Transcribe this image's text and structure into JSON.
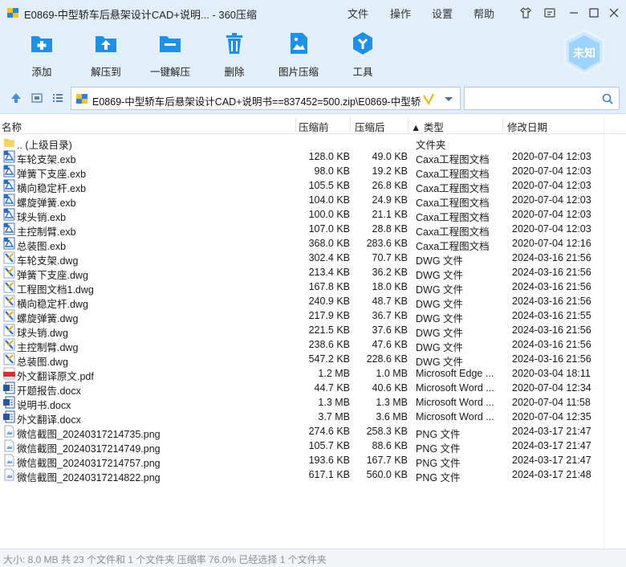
{
  "window": {
    "title": "E0869-中型轿车后悬架设计CAD+说明... - 360压缩",
    "menus": [
      "文件",
      "操作",
      "设置",
      "帮助"
    ]
  },
  "toolbar": {
    "buttons": [
      {
        "label": "添加",
        "icon": "add-icon"
      },
      {
        "label": "解压到",
        "icon": "extract-to-icon"
      },
      {
        "label": "一键解压",
        "icon": "quick-extract-icon"
      },
      {
        "label": "删除",
        "icon": "trash-icon"
      },
      {
        "label": "图片压缩",
        "icon": "image-compress-icon"
      },
      {
        "label": "工具",
        "icon": "tools-icon"
      }
    ],
    "badge": "未知"
  },
  "address": {
    "path": "E0869-中型轿车后悬架设计CAD+说明书==837452=500.zip\\E0869-中型轿",
    "search_placeholder": ""
  },
  "columns": {
    "name": "名称",
    "size": "压缩前",
    "packed": "压缩后",
    "type": "▲ 类型",
    "modified": "修改日期"
  },
  "files": [
    {
      "name": ".. (上级目录)",
      "size": "",
      "packed": "",
      "type": "文件夹",
      "date": "",
      "icon": "folder-up"
    },
    {
      "name": "车轮支架.exb",
      "size": "128.0 KB",
      "packed": "49.0 KB",
      "type": "Caxa工程图文档",
      "date": "2020-07-04 12:03",
      "icon": "exb"
    },
    {
      "name": "弹簧下支座.exb",
      "size": "98.0 KB",
      "packed": "19.2 KB",
      "type": "Caxa工程图文档",
      "date": "2020-07-04 12:03",
      "icon": "exb"
    },
    {
      "name": "横向稳定杆.exb",
      "size": "105.5 KB",
      "packed": "26.8 KB",
      "type": "Caxa工程图文档",
      "date": "2020-07-04 12:03",
      "icon": "exb"
    },
    {
      "name": "螺旋弹簧.exb",
      "size": "104.0 KB",
      "packed": "24.9 KB",
      "type": "Caxa工程图文档",
      "date": "2020-07-04 12:03",
      "icon": "exb"
    },
    {
      "name": "球头销.exb",
      "size": "100.0 KB",
      "packed": "21.1 KB",
      "type": "Caxa工程图文档",
      "date": "2020-07-04 12:03",
      "icon": "exb"
    },
    {
      "name": "主控制臂.exb",
      "size": "107.0 KB",
      "packed": "28.8 KB",
      "type": "Caxa工程图文档",
      "date": "2020-07-04 12:03",
      "icon": "exb"
    },
    {
      "name": "总装图.exb",
      "size": "368.0 KB",
      "packed": "283.6 KB",
      "type": "Caxa工程图文档",
      "date": "2020-07-04 12:16",
      "icon": "exb"
    },
    {
      "name": "车轮支架.dwg",
      "size": "302.4 KB",
      "packed": "70.7 KB",
      "type": "DWG 文件",
      "date": "2024-03-16 21:56",
      "icon": "dwg"
    },
    {
      "name": "弹簧下支座.dwg",
      "size": "213.4 KB",
      "packed": "36.2 KB",
      "type": "DWG 文件",
      "date": "2024-03-16 21:56",
      "icon": "dwg"
    },
    {
      "name": "工程图文档1.dwg",
      "size": "167.8 KB",
      "packed": "18.0 KB",
      "type": "DWG 文件",
      "date": "2024-03-16 21:56",
      "icon": "dwg"
    },
    {
      "name": "横向稳定杆.dwg",
      "size": "240.9 KB",
      "packed": "48.7 KB",
      "type": "DWG 文件",
      "date": "2024-03-16 21:56",
      "icon": "dwg"
    },
    {
      "name": "螺旋弹簧.dwg",
      "size": "217.9 KB",
      "packed": "36.7 KB",
      "type": "DWG 文件",
      "date": "2024-03-16 21:55",
      "icon": "dwg"
    },
    {
      "name": "球头销.dwg",
      "size": "221.5 KB",
      "packed": "37.6 KB",
      "type": "DWG 文件",
      "date": "2024-03-16 21:56",
      "icon": "dwg"
    },
    {
      "name": "主控制臂.dwg",
      "size": "238.6 KB",
      "packed": "47.6 KB",
      "type": "DWG 文件",
      "date": "2024-03-16 21:56",
      "icon": "dwg"
    },
    {
      "name": "总装图.dwg",
      "size": "547.2 KB",
      "packed": "228.6 KB",
      "type": "DWG 文件",
      "date": "2024-03-16 21:56",
      "icon": "dwg"
    },
    {
      "name": "外文翻译原文.pdf",
      "size": "1.2 MB",
      "packed": "1.0 MB",
      "type": "Microsoft Edge ...",
      "date": "2020-03-04 18:11",
      "icon": "pdf"
    },
    {
      "name": "开题报告.docx",
      "size": "44.7 KB",
      "packed": "40.6 KB",
      "type": "Microsoft Word ...",
      "date": "2020-07-04 12:34",
      "icon": "docx"
    },
    {
      "name": "说明书.docx",
      "size": "1.3 MB",
      "packed": "1.3 MB",
      "type": "Microsoft Word ...",
      "date": "2020-07-04 11:58",
      "icon": "docx"
    },
    {
      "name": "外文翻译.docx",
      "size": "3.7 MB",
      "packed": "3.6 MB",
      "type": "Microsoft Word ...",
      "date": "2020-07-04 12:35",
      "icon": "docx"
    },
    {
      "name": "微信截图_20240317214735.png",
      "size": "274.6 KB",
      "packed": "258.3 KB",
      "type": "PNG 文件",
      "date": "2024-03-17 21:47",
      "icon": "png"
    },
    {
      "name": "微信截图_20240317214749.png",
      "size": "105.7 KB",
      "packed": "88.6 KB",
      "type": "PNG 文件",
      "date": "2024-03-17 21:47",
      "icon": "png"
    },
    {
      "name": "微信截图_20240317214757.png",
      "size": "193.6 KB",
      "packed": "167.7 KB",
      "type": "PNG 文件",
      "date": "2024-03-17 21:47",
      "icon": "png"
    },
    {
      "name": "微信截图_20240317214822.png",
      "size": "617.1 KB",
      "packed": "560.0 KB",
      "type": "PNG 文件",
      "date": "2024-03-17 21:48",
      "icon": "png"
    }
  ],
  "status": {
    "text": "大小: 8.0 MB 共 23 个文件和 1 个文件夹 压缩率 76.0% 已经选择 1 个文件夹"
  },
  "colors": {
    "chrome_bg": "#e3eefb",
    "accent": "#1e90e6",
    "badge": "#9fd3ff"
  }
}
